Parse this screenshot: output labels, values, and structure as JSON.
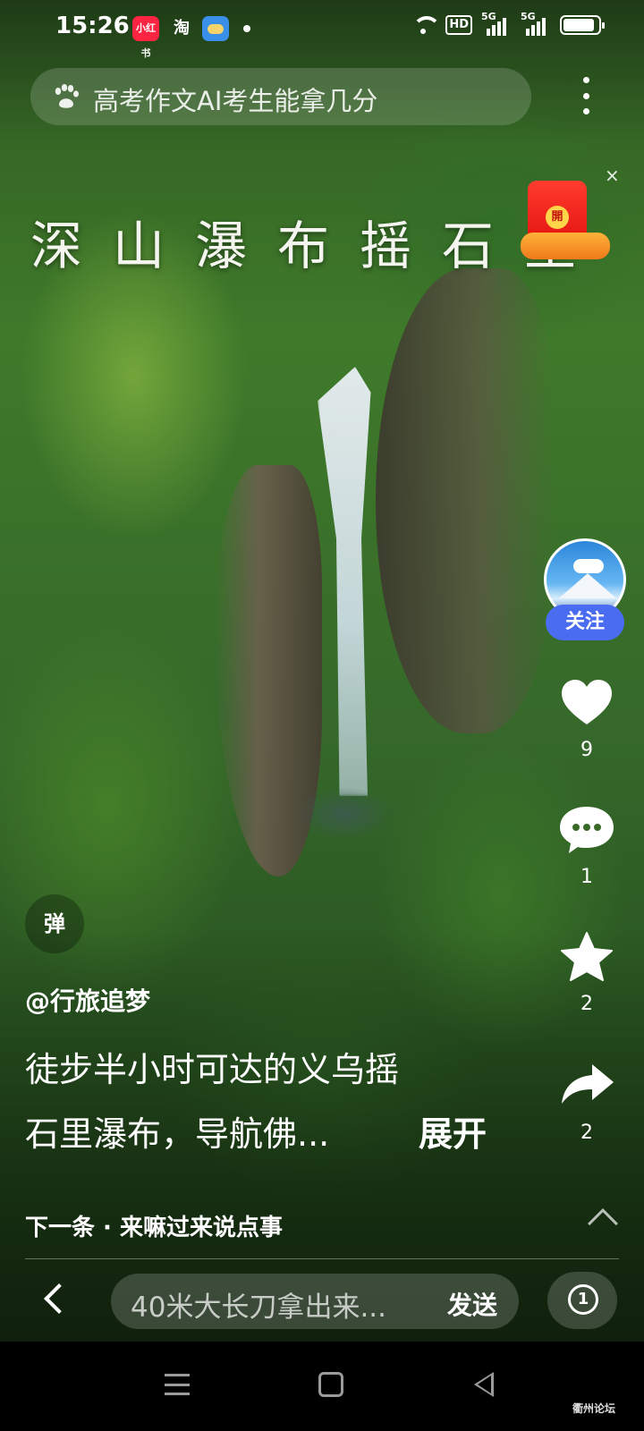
{
  "status_bar": {
    "time": "15:26",
    "app_icons": [
      "小红书",
      "淘",
      "weather"
    ],
    "hd_label": "HD",
    "signal_labels": [
      "5G",
      "5G"
    ]
  },
  "search": {
    "query": "高考作文AI考生能拿几分",
    "icon": "baidu-paw-icon"
  },
  "video": {
    "overlay_title": "深山瀑布摇石里"
  },
  "red_packet": {
    "coin_label": "開",
    "close_label": "×"
  },
  "author": {
    "follow_label": "关注",
    "username": "@行旅追梦"
  },
  "actions": {
    "like_count": "9",
    "comment_count": "1",
    "favorite_count": "2",
    "share_count": "2"
  },
  "description": {
    "line1": "徒步半小时可达的义乌摇",
    "line2": "石里瀑布，导航佛...",
    "expand_label": "展开"
  },
  "danmu_toggle": "弹",
  "next_up": "下一条 · 来嘛过来说点事",
  "comment_bar": {
    "placeholder": "40米大长刀拿出来...",
    "send_label": "发送",
    "replay_label": "1"
  },
  "watermark": "衢州论坛",
  "colors": {
    "follow_button": "#4a6cf0",
    "red_packet": "#e3140f"
  }
}
